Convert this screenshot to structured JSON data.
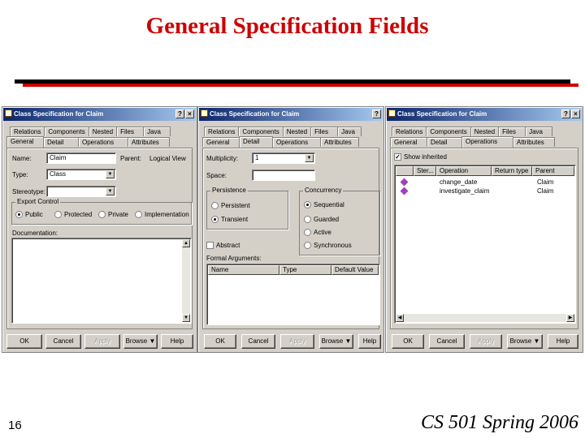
{
  "slide": {
    "title": "General Specification Fields",
    "page_number": "16",
    "course": "CS 501 Spring 2006"
  },
  "colors": {
    "title": "#cc0000",
    "rule": "#cc0000",
    "dialog_bg": "#d4d0c8",
    "titlebar": "#0a246a"
  },
  "dialog": {
    "title": "Class Specification for Claim",
    "help_glyph": "?",
    "close_glyph": "×",
    "tabs_top": [
      "Relations",
      "Components",
      "Nested",
      "Files",
      "Java"
    ],
    "tabs_bottom": [
      "General",
      "Detail",
      "Operations",
      "Attributes"
    ],
    "buttons": {
      "ok": "OK",
      "cancel": "Cancel",
      "apply": "Apply",
      "browse": "Browse ▼",
      "help": "Help"
    }
  },
  "general": {
    "name_label": "Name:",
    "name_value": "Claim",
    "parent_label": "Parent:",
    "parent_value": "Logical View",
    "type_label": "Type:",
    "type_value": "Class",
    "stereotype_label": "Stereotype:",
    "stereotype_value": "",
    "export_control_label": "Export Control",
    "export_options": [
      "Public",
      "Protected",
      "Private",
      "Implementation"
    ],
    "export_selected": "Public",
    "documentation_label": "Documentation:"
  },
  "detail": {
    "multiplicity_label": "Multiplicity:",
    "multiplicity_value": "1",
    "space_label": "Space:",
    "space_value": "",
    "persistence_label": "Persistence",
    "persistence_options": [
      "Persistent",
      "Transient"
    ],
    "persistence_selected": "Transient",
    "concurrency_label": "Concurrency",
    "concurrency_options": [
      "Sequential",
      "Guarded",
      "Active",
      "Synchronous"
    ],
    "concurrency_selected": "Sequential",
    "abstract_label": "Abstract",
    "formal_arguments_label": "Formal Arguments:",
    "formal_columns": [
      "Name",
      "Type",
      "Default Value"
    ]
  },
  "operations": {
    "show_inherited_label": "Show inherited",
    "show_inherited_checked": true,
    "columns": [
      "Ster...",
      "Operation",
      "Return type",
      "Parent"
    ],
    "rows": [
      {
        "stereotype": "",
        "operation": "change_date",
        "return_type": "",
        "parent": "Claim"
      },
      {
        "stereotype": "",
        "operation": "investigate_claim",
        "return_type": "",
        "parent": "Claim"
      }
    ]
  }
}
